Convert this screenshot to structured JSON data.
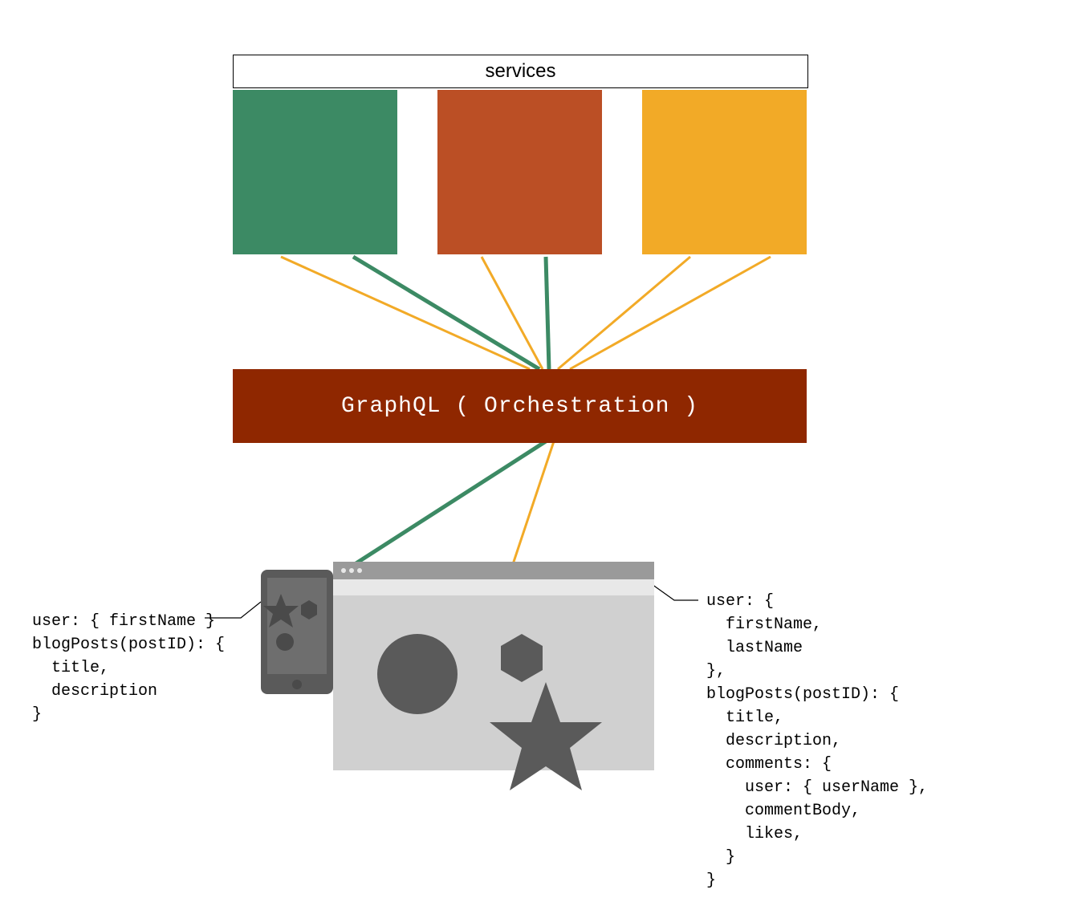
{
  "colors": {
    "green": "#3c8a64",
    "red": "#bb4f25",
    "orange": "#f2aa27",
    "orchBg": "#8f2700",
    "lineGreen": "#3c8a64",
    "lineOrange": "#f2aa27",
    "lightGrey": "#d0d0d0",
    "midGrey": "#9a9a9a",
    "darkGrey": "#5a5a5a",
    "browserBar": "#e8e8e8"
  },
  "header": {
    "label": "services"
  },
  "orchestration": {
    "label": "GraphQL ( Orchestration )"
  },
  "clients": {
    "mobile": {
      "query": "user: { firstName }\nblogPosts(postID): {\n  title,\n  description\n}"
    },
    "desktop": {
      "query": "user: {\n  firstName,\n  lastName\n},\nblogPosts(postID): {\n  title,\n  description,\n  comments: {\n    user: { userName },\n    commentBody,\n    likes,\n  }\n}"
    }
  }
}
